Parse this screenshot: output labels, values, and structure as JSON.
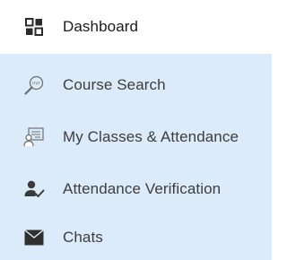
{
  "menu": {
    "items": [
      {
        "label": "Dashboard",
        "icon": "dashboard-grid-icon",
        "active": true
      },
      {
        "label": "Course Search",
        "icon": "course-search-icon",
        "active": false
      },
      {
        "label": "My Classes & Attendance",
        "icon": "classes-attendance-icon",
        "active": false
      },
      {
        "label": "Attendance Verification",
        "icon": "attendance-verification-icon",
        "active": false
      },
      {
        "label": "Chats",
        "icon": "envelope-icon",
        "active": false
      }
    ]
  },
  "colors": {
    "menu_background": "#dcebfa",
    "active_icon": "#2b2b2b",
    "inactive_icon": "#6f6f6f"
  }
}
